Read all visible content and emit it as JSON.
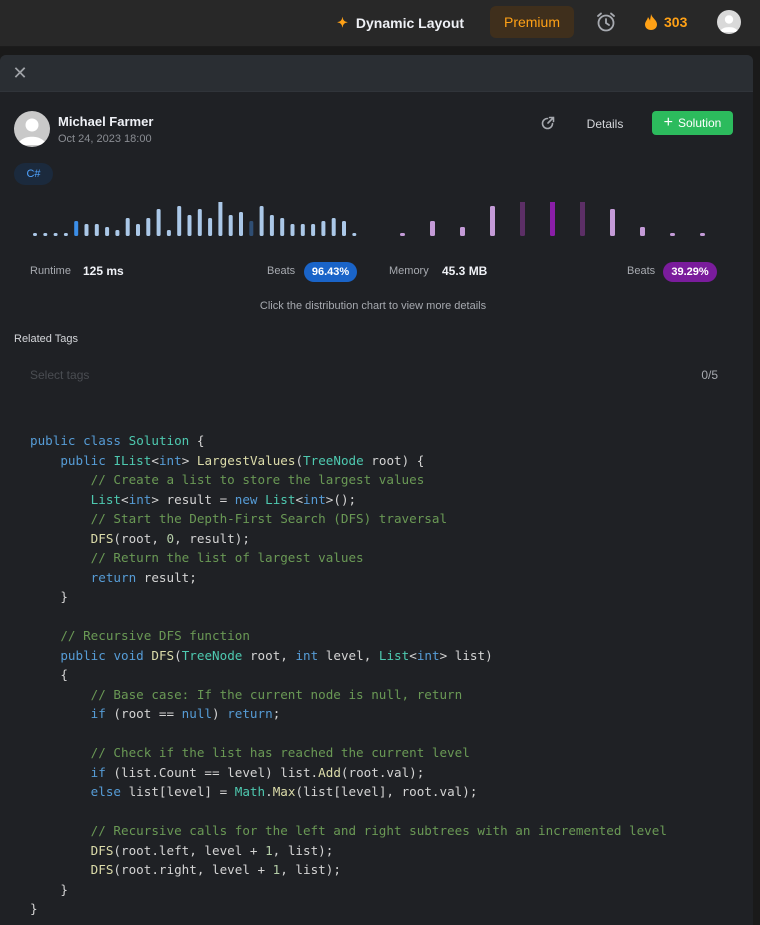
{
  "nav": {
    "feature_label": "Dynamic Layout",
    "premium_label": "Premium",
    "streak_count": "303"
  },
  "author": {
    "name": "Michael Farmer",
    "date": "Oct 24, 2023 18:00"
  },
  "actions": {
    "details_label": "Details",
    "solution_label": "Solution"
  },
  "language_tag": "C#",
  "stats": {
    "runtime_label": "Runtime",
    "runtime_value": "125 ms",
    "runtime_beats_label": "Beats",
    "runtime_beats_value": "96.43%",
    "memory_label": "Memory",
    "memory_value": "45.3 MB",
    "memory_beats_label": "Beats",
    "memory_beats_value": "39.29%"
  },
  "chart_data": [
    {
      "type": "bar",
      "series": [
        {
          "values": [
            1,
            1,
            1,
            1,
            5,
            4,
            4,
            3,
            2,
            6,
            4,
            6,
            9,
            2,
            10,
            7,
            9,
            6,
            13,
            7,
            8,
            5,
            10,
            7,
            6,
            4,
            4,
            4,
            5,
            6,
            5,
            1
          ]
        }
      ],
      "highlight_index": 4,
      "selected_index": 21,
      "colors": {
        "base": "#abc8e8",
        "highlight": "#3b8ee8",
        "selected": "#2f4e73"
      }
    },
    {
      "type": "bar",
      "series": [
        {
          "values": [
            1,
            5,
            3,
            10,
            15,
            15,
            12,
            9,
            3,
            1,
            1
          ]
        }
      ],
      "highlight_index": 5,
      "colors": {
        "base": "#c49bd8",
        "highlight": "#8a1ea8",
        "dim": "#5c2f66"
      }
    }
  ],
  "hint_text": "Click the distribution chart to view more details",
  "related_tags": {
    "label": "Related Tags",
    "placeholder": "Select tags",
    "count": "0/5"
  },
  "code_lines": [
    "public class Solution {",
    "    public IList<int> LargestValues(TreeNode root) {",
    "        // Create a list to store the largest values",
    "        List<int> result = new List<int>();",
    "        // Start the Depth-First Search (DFS) traversal",
    "        DFS(root, 0, result);",
    "        // Return the list of largest values",
    "        return result;",
    "    }",
    "",
    "    // Recursive DFS function",
    "    public void DFS(TreeNode root, int level, List<int> list)",
    "    {",
    "        // Base case: If the current node is null, return",
    "        if (root == null) return;",
    "",
    "        // Check if the list has reached the current level",
    "        if (list.Count == level) list.Add(root.val);",
    "        else list[level] = Math.Max(list[level], root.val);",
    "",
    "        // Recursive calls for the left and right subtrees with an incremented level",
    "        DFS(root.left, level + 1, list);",
    "        DFS(root.right, level + 1, list);",
    "    }",
    "}"
  ]
}
